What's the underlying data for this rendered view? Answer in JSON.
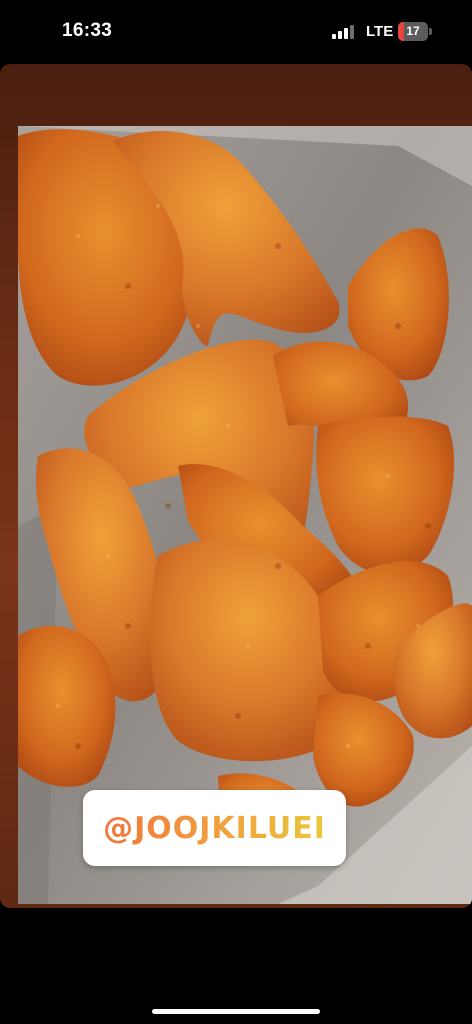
{
  "status_bar": {
    "time": "16:33",
    "carrier": "LTE",
    "battery_level": "17",
    "battery_color": "#e5453a",
    "signal_bars_active": 3,
    "signal_bars_total": 4
  },
  "story": {
    "background_color": "#6b2d15",
    "photo_icon": "chicken-wings-photo",
    "mention_sticker": {
      "text": "@JOOJKILUEI",
      "gradient": [
        "#f0743a",
        "#f29a3d",
        "#e9c83c"
      ]
    }
  }
}
